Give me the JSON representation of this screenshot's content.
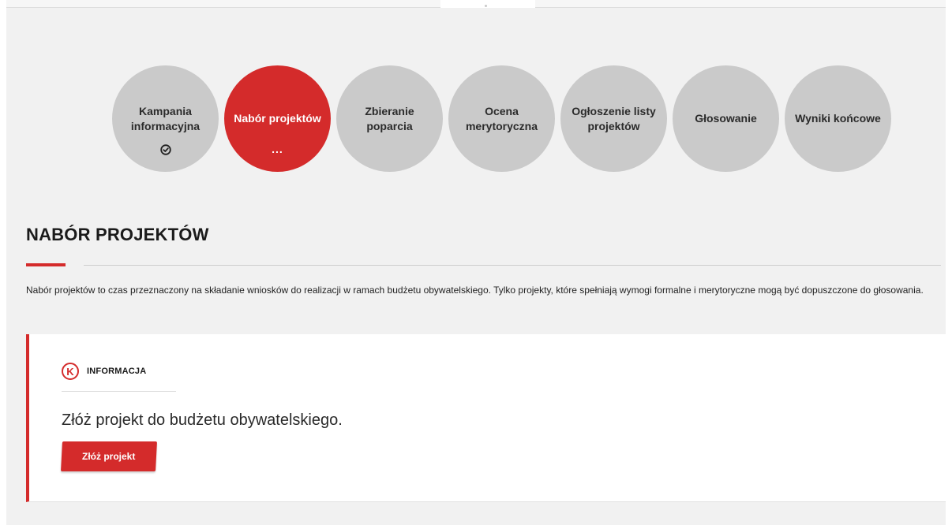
{
  "steps": [
    {
      "label": "Kampania informacyjna",
      "state": "done",
      "icon": "check-circle-icon"
    },
    {
      "label": "Nabór projektów",
      "state": "active",
      "extra": "..."
    },
    {
      "label": "Zbieranie poparcia",
      "state": "upcoming"
    },
    {
      "label": "Ocena merytoryczna",
      "state": "upcoming"
    },
    {
      "label": "Ogłoszenie listy projektów",
      "state": "upcoming"
    },
    {
      "label": "Głosowanie",
      "state": "upcoming"
    },
    {
      "label": "Wyniki końcowe",
      "state": "upcoming"
    }
  ],
  "section": {
    "title": "NABÓR PROJEKTÓW",
    "description": "Nabór projektów to czas przeznaczony na składanie wniosków do realizacji w ramach budżetu obywatelskiego. Tylko projekty, które spełniają wymogi formalne i merytoryczne mogą być dopuszczone do głosowania."
  },
  "info": {
    "icon_letter": "K",
    "label": "INFORMACJA",
    "text": "Złóż projekt do budżetu obywatelskiego.",
    "button": "Złóż projekt"
  },
  "colors": {
    "accent": "#d42b2b",
    "step_inactive": "#cacaca",
    "page_background": "#f1f1f1"
  }
}
